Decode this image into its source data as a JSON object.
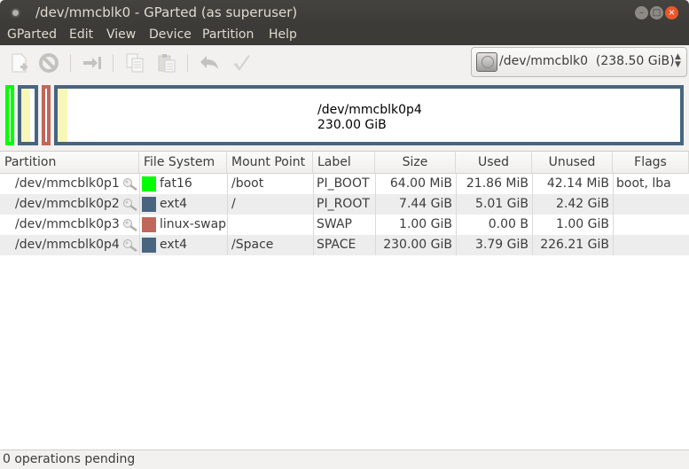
{
  "window": {
    "title": "/dev/mmcblk0 - GParted (as superuser)",
    "controls": [
      "minimize",
      "maximize",
      "close"
    ]
  },
  "menubar": {
    "items": [
      "GParted",
      "Edit",
      "View",
      "Device",
      "Partition",
      "Help"
    ]
  },
  "toolbar": {
    "buttons": [
      {
        "name": "new-partition",
        "icon": "new-document-icon",
        "enabled": false
      },
      {
        "name": "delete-partition",
        "icon": "no-entry-icon",
        "enabled": false
      },
      {
        "name": "resize-move",
        "icon": "arrow-to-bar-icon",
        "enabled": false
      },
      {
        "name": "copy",
        "icon": "copy-icon",
        "enabled": false
      },
      {
        "name": "paste",
        "icon": "paste-icon",
        "enabled": false
      },
      {
        "name": "undo",
        "icon": "undo-arrow-icon",
        "enabled": false
      },
      {
        "name": "apply",
        "icon": "checkmark-icon",
        "enabled": false
      }
    ]
  },
  "device_selector": {
    "device": "/dev/mmcblk0",
    "size": "(238.50 GiB)",
    "label": "/dev/mmcblk0  (238.50 GiB)"
  },
  "disk_map": {
    "selected": {
      "name": "/dev/mmcblk0p4",
      "size": "230.00 GiB"
    },
    "segments": [
      {
        "partition": "/dev/mmcblk0p1",
        "color": "#00ff00",
        "used_fraction": 0.34
      },
      {
        "partition": "/dev/mmcblk0p2",
        "color": "#486580",
        "used_fraction": 0.67
      },
      {
        "partition": "/dev/mmcblk0p3",
        "color": "#c1665a",
        "used_fraction": 0.0
      },
      {
        "partition": "/dev/mmcblk0p4",
        "color": "#486580",
        "used_fraction": 0.016
      }
    ]
  },
  "table": {
    "columns": [
      "Partition",
      "File System",
      "Mount Point",
      "Label",
      "Size",
      "Used",
      "Unused",
      "Flags"
    ],
    "rows": [
      {
        "partition": "/dev/mmcblk0p1",
        "fs": "fat16",
        "fs_color": "#00ff00",
        "mount": "/boot",
        "label": "PI_BOOT",
        "size": "64.00 MiB",
        "used": "21.86 MiB",
        "unused": "42.14 MiB",
        "flags": "boot, lba"
      },
      {
        "partition": "/dev/mmcblk0p2",
        "fs": "ext4",
        "fs_color": "#486580",
        "mount": "/",
        "label": "PI_ROOT",
        "size": "7.44 GiB",
        "used": "5.01 GiB",
        "unused": "2.42 GiB",
        "flags": ""
      },
      {
        "partition": "/dev/mmcblk0p3",
        "fs": "linux-swap",
        "fs_color": "#c1665a",
        "mount": "",
        "label": "SWAP",
        "size": "1.00 GiB",
        "used": "0.00 B",
        "unused": "1.00 GiB",
        "flags": ""
      },
      {
        "partition": "/dev/mmcblk0p4",
        "fs": "ext4",
        "fs_color": "#486580",
        "mount": "/Space",
        "label": "SPACE",
        "size": "230.00 GiB",
        "used": "3.79 GiB",
        "unused": "226.21 GiB",
        "flags": ""
      }
    ]
  },
  "statusbar": {
    "text": "0 operations pending"
  }
}
